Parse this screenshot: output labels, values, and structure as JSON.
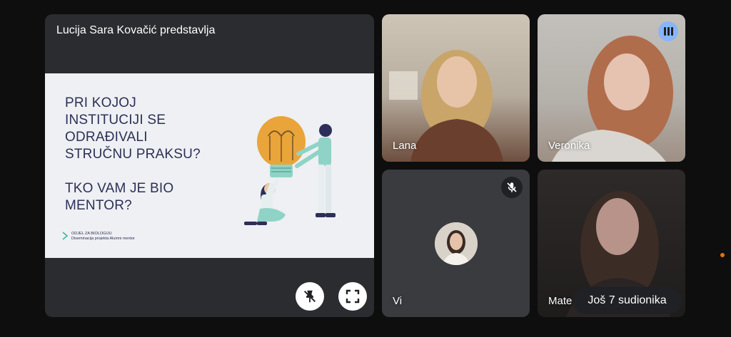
{
  "presentation": {
    "presenter_label": "Lucija Sara Kovačić predstavlja",
    "slide": {
      "line1": "PRI KOJOJ",
      "line2": "INSTITUCIJI SE",
      "line3": "ODRAĐIVALI",
      "line4": "STRUČNU PRAKSU?",
      "line5": "TKO VAM JE BIO",
      "line6": "MENTOR?",
      "logo_line1": "ODJEL ZA BIOLOGIJU",
      "logo_line2": "Diseminacija projekta Alumni mentor"
    },
    "controls": {
      "unpin_icon": "unpin-icon",
      "fullscreen_icon": "fullscreen-icon"
    }
  },
  "participants": [
    {
      "name": "Lana"
    },
    {
      "name": "Veronika",
      "status_icon": "speaking-icon"
    },
    {
      "name": "Vi",
      "status_icon": "mic-off-icon"
    },
    {
      "name": "Mate"
    }
  ],
  "more_participants_label": "Još 7 sudionika",
  "colors": {
    "background": "#0e0e0f",
    "tile": "#3c4043",
    "speaking": "#8ab4f8",
    "slide_text": "#2d3057",
    "bulb": "#e9a43a",
    "teal": "#8fd3c6"
  }
}
